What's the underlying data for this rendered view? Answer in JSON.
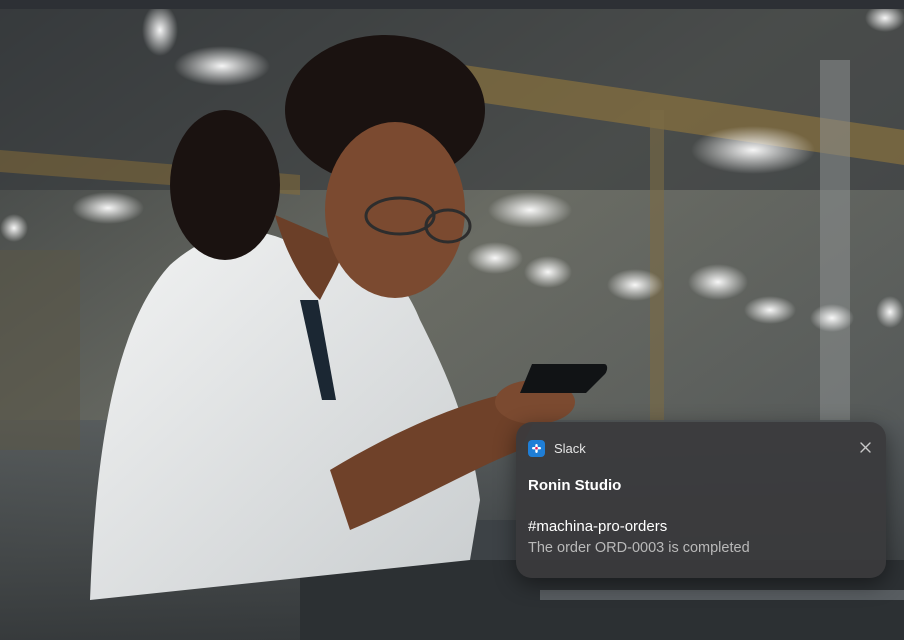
{
  "notification": {
    "app_name": "Slack",
    "app_icon": "slack-icon",
    "close_icon": "close-icon",
    "sender": "Ronin Studio",
    "channel": "#machina-pro-orders",
    "message": "The order ORD-0003 is completed"
  },
  "colors": {
    "toast_background": "#3a3a3c",
    "app_icon_background": "#1f7ed6",
    "message_text": "#b9b9b9"
  }
}
